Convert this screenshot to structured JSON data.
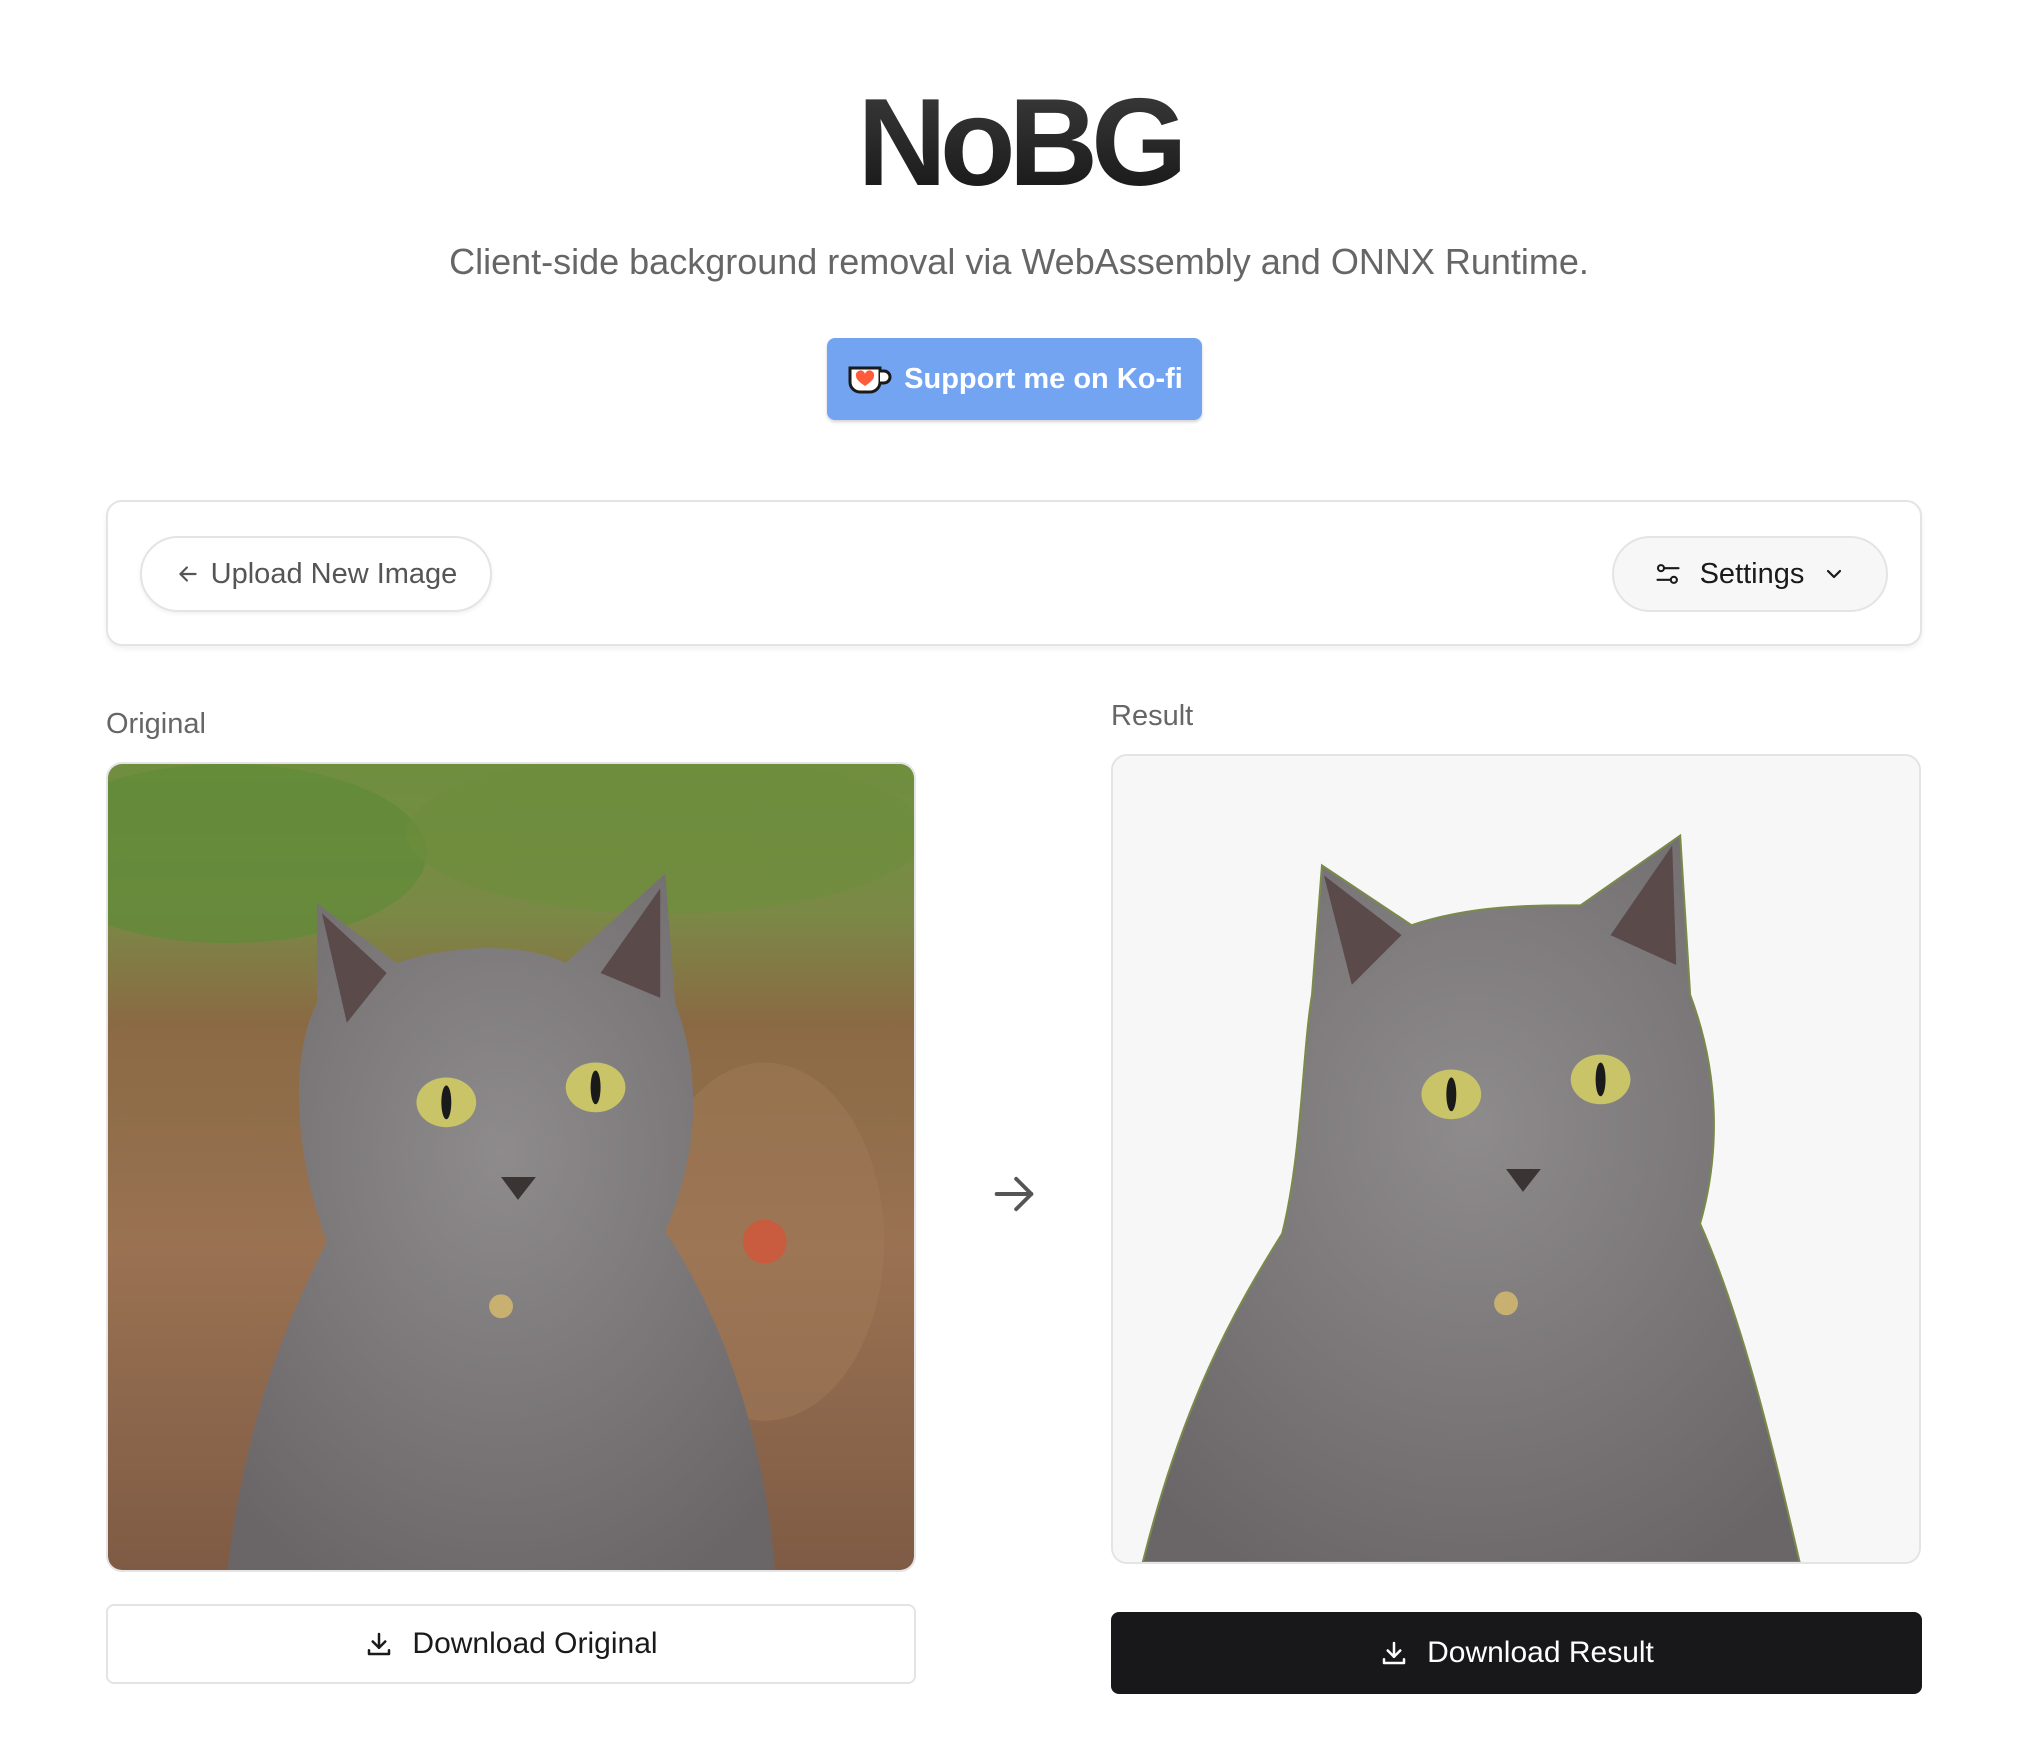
{
  "header": {
    "title": "NoBG",
    "subtitle": "Client-side background removal via WebAssembly and ONNX Runtime.",
    "kofi_label": "Support me on Ko-fi",
    "kofi_icon": "kofi-cup-icon"
  },
  "toolbar": {
    "upload_label": "Upload New Image",
    "upload_icon": "arrow-left-icon",
    "settings_label": "Settings",
    "settings_icon": "sliders-icon",
    "settings_chevron_icon": "chevron-down-icon"
  },
  "panels": {
    "original_label": "Original",
    "result_label": "Result",
    "original_image": "gray-cat-photo",
    "result_image": "gray-cat-background-removed"
  },
  "actions": {
    "download_original_label": "Download Original",
    "download_result_label": "Download Result",
    "download_icon": "download-icon",
    "divider_icon": "arrow-right-icon"
  },
  "colors": {
    "kofi_button": "#72a4f2",
    "primary_button": "#18181b",
    "border": "#e4e4e7",
    "muted_text": "#666666"
  }
}
